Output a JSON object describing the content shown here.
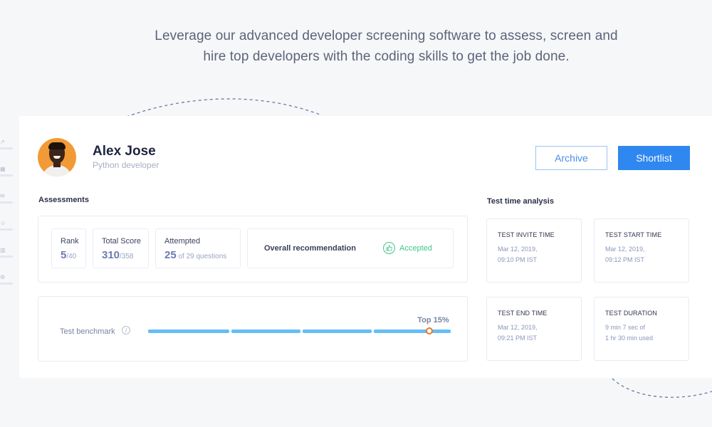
{
  "tagline": {
    "line1": "Leverage our advanced developer screening software to assess, screen and",
    "line2": "hire top developers with the coding skills to get the job done."
  },
  "side_rail": {
    "icons": [
      "trend-icon",
      "calendar-icon",
      "mail-icon",
      "people-icon",
      "chart-icon",
      "settings-icon"
    ]
  },
  "candidate": {
    "name": "Alex Jose",
    "role": "Python developer"
  },
  "actions": {
    "archive_label": "Archive",
    "shortlist_label": "Shortlist"
  },
  "assessments": {
    "title": "Assessments",
    "rank": {
      "label": "Rank",
      "value": "5",
      "total": "/40"
    },
    "total_score": {
      "label": "Total Score",
      "value": "310",
      "total": "/358"
    },
    "attempted": {
      "label": "Attempted",
      "value": "25",
      "total": " of 29 questions"
    },
    "recommendation": {
      "label": "Overall recommendation",
      "status": "Accepted"
    }
  },
  "benchmark": {
    "label": "Test benchmark",
    "top_label": "Top 15%",
    "percentile_position": 0.93
  },
  "time_analysis": {
    "title": "Test time analysis",
    "cards": [
      {
        "heading": "TEST INVITE TIME",
        "line1": "Mar 12, 2019,",
        "line2": "09:10 PM IST"
      },
      {
        "heading": "TEST START TIME",
        "line1": "Mar 12, 2019,",
        "line2": "09:12 PM IST"
      },
      {
        "heading": "TEST END TIME",
        "line1": "Mar 12, 2019,",
        "line2": "09:21 PM IST"
      },
      {
        "heading": "TEST DURATION",
        "line1": "9 min 7 sec of",
        "line2": "1 hr 30 min used"
      }
    ]
  },
  "colors": {
    "primary": "#2f87f0",
    "accepted": "#3fc58c",
    "benchmark_bar": "#66bdf5",
    "marker": "#e87a24"
  }
}
